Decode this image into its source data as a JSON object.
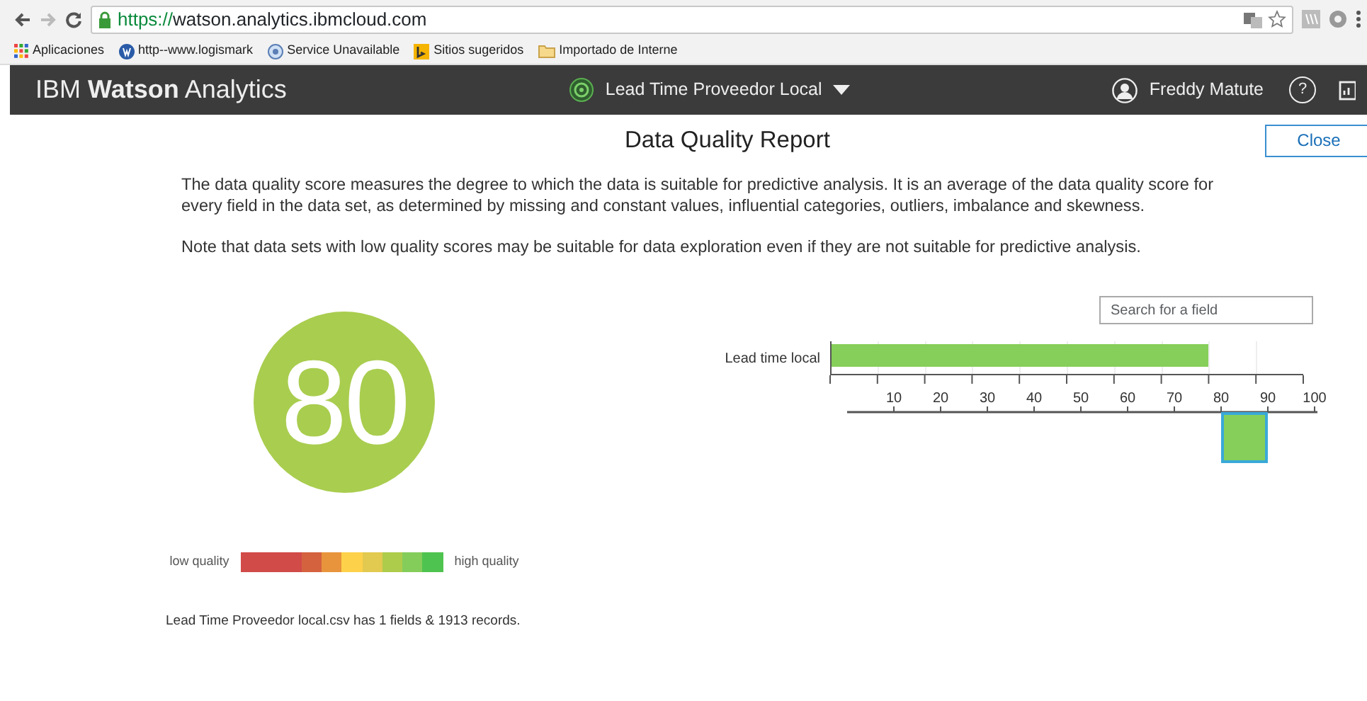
{
  "browser": {
    "url_scheme": "https://",
    "url_host": "watson.analytics.ibmcloud.com",
    "bookmarks": [
      {
        "label": "Aplicaciones",
        "kind": "apps"
      },
      {
        "label": "http--www.logismark",
        "kind": "site"
      },
      {
        "label": "Service Unavailable",
        "kind": "globe"
      },
      {
        "label": "Sitios sugeridos",
        "kind": "bing"
      },
      {
        "label": "Importado de Interne",
        "kind": "folder"
      }
    ]
  },
  "app_header": {
    "brand": "IBM **Watson** Analytics",
    "dataset": "Lead Time Proveedor Local",
    "user": "Freddy Matute",
    "help": "?"
  },
  "report": {
    "title": "Data Quality Report",
    "close": "Close",
    "paragraphs": [
      "The data quality score measures the degree to which the data is suitable for predictive analysis. It is an average of the data quality score for every field in the data set, as determined by missing and constant values, influential categories, outliers, imbalance and skewness.",
      "Note that data sets with low quality scores may be suitable for data exploration even if they are not suitable for predictive analysis."
    ],
    "score": "80",
    "scale": {
      "low_label": "low quality",
      "high_label": "high quality",
      "segments": [
        {
          "color": "#d14b48"
        },
        {
          "color": "#d4623f"
        },
        {
          "color": "#e8943c"
        },
        {
          "color": "#fdd14a"
        },
        {
          "color": "#e2c94f"
        },
        {
          "color": "#aecc4b"
        },
        {
          "color": "#84cd5b"
        },
        {
          "color": "#4fc34f"
        }
      ]
    },
    "summary": "Lead Time Proveedor local.csv has 1 fields & 1913 records.",
    "search": {
      "placeholder": "Search for a field"
    },
    "field_chart": {
      "fields": [
        {
          "label": "Lead time local",
          "level": 0.8
        }
      ]
    },
    "distribution": {
      "bins": [
        {
          "label": "10",
          "selected": false
        },
        {
          "label": "20",
          "selected": false
        },
        {
          "label": "30",
          "selected": false
        },
        {
          "label": "40",
          "selected": false
        },
        {
          "label": "50",
          "selected": false
        },
        {
          "label": "60",
          "selected": false
        },
        {
          "label": "70",
          "selected": false
        },
        {
          "label": "80",
          "selected": false
        },
        {
          "label": "90",
          "selected": true
        },
        {
          "label": "100",
          "selected": false
        }
      ]
    }
  }
}
